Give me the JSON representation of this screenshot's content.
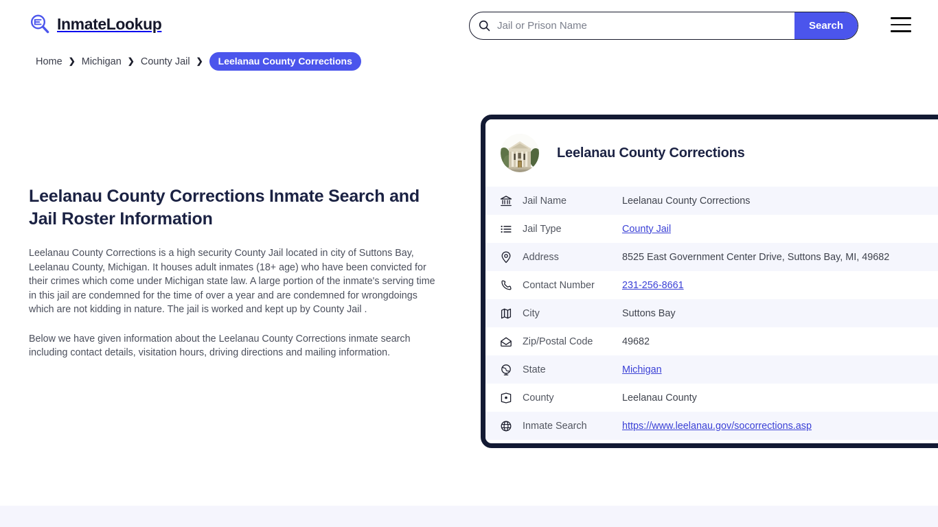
{
  "header": {
    "logo_text": "InmateLookup",
    "logo_icon": "magnifier-list-icon",
    "search": {
      "placeholder": "Jail or Prison Name",
      "value": "",
      "button_label": "Search",
      "icon": "search-icon"
    },
    "menu_icon": "hamburger-menu-icon"
  },
  "breadcrumb": {
    "items": [
      {
        "label": "Home",
        "current": false
      },
      {
        "label": "Michigan",
        "current": false
      },
      {
        "label": "County Jail",
        "current": false
      },
      {
        "label": "Leelanau County Corrections",
        "current": true
      }
    ],
    "separator": "❯"
  },
  "main": {
    "title": "Leelanau County Corrections Inmate Search and Jail Roster Information",
    "paragraph_1": "Leelanau County Corrections is a high security County Jail located in city of Suttons Bay, Leelanau County, Michigan. It houses adult inmates (18+ age) who have been convicted for their crimes which come under Michigan state law. A large portion of the inmate's serving time in this jail are condemned for the time of over a year and are condemned for wrongdoings which are not kidding in nature. The jail is worked and kept up by County Jail .",
    "paragraph_2": "Below we have given information about the Leelanau County Corrections inmate search including contact details, visitation hours, driving directions and mailing information."
  },
  "card": {
    "title": "Leelanau County Corrections",
    "avatar_icon": "courthouse-building-photo",
    "rows": [
      {
        "icon": "bank-landmark-icon",
        "label": "Jail Name",
        "value": "Leelanau County Corrections",
        "is_link": false
      },
      {
        "icon": "list-icon",
        "label": "Jail Type",
        "value": "County Jail",
        "is_link": true
      },
      {
        "icon": "map-pin-icon",
        "label": "Address",
        "value": "8525 East Government Center Drive, Suttons Bay, MI, 49682",
        "is_link": false
      },
      {
        "icon": "phone-icon",
        "label": "Contact Number",
        "value": "231-256-8661",
        "is_link": true
      },
      {
        "icon": "map-icon",
        "label": "City",
        "value": "Suttons Bay",
        "is_link": false
      },
      {
        "icon": "open-envelope-icon",
        "label": "Zip/Postal Code",
        "value": "49682",
        "is_link": false
      },
      {
        "icon": "globe-stand-icon",
        "label": "State",
        "value": "Michigan",
        "is_link": true
      },
      {
        "icon": "map-location-icon",
        "label": "County",
        "value": "Leelanau County",
        "is_link": false
      },
      {
        "icon": "globe-icon",
        "label": "Inmate Search",
        "value": "https://www.leelanau.gov/socorrections.asp",
        "is_link": true
      }
    ]
  },
  "colors": {
    "accent": "#4b55ec",
    "link": "#3b41d6",
    "card_border": "#131a33",
    "row_alt": "#f5f6fd",
    "heading": "#1b2243",
    "footer_band": "#f5f5fd"
  }
}
